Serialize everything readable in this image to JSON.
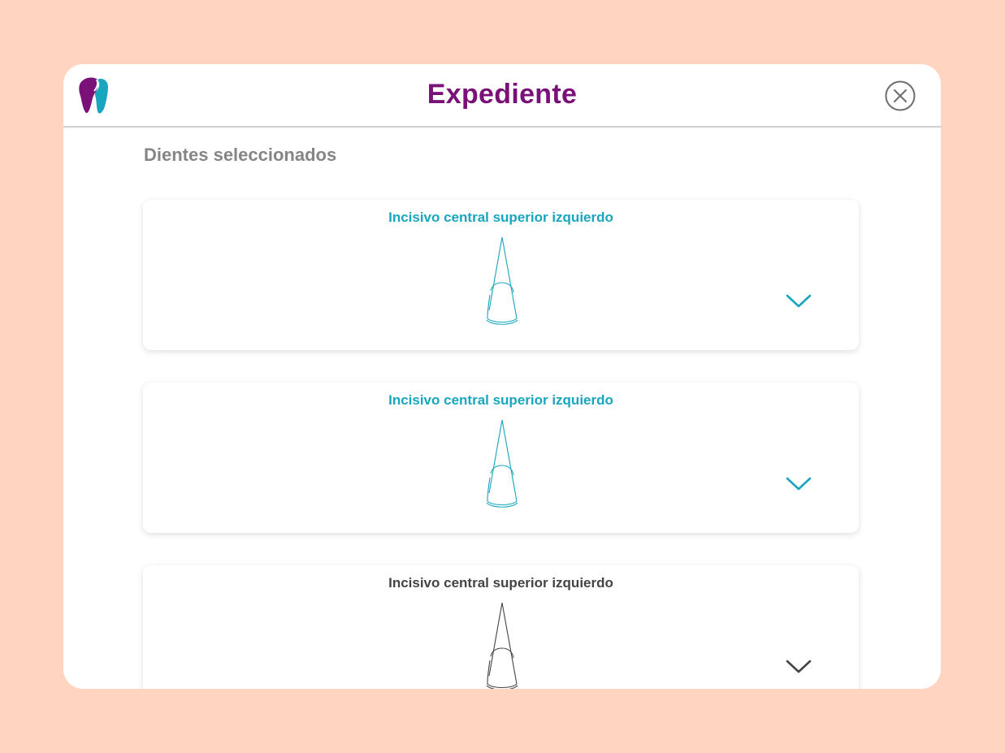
{
  "header": {
    "title": "Expediente",
    "logo_icon": "tooth-logo-icon",
    "close_icon": "close-circle-icon"
  },
  "section": {
    "title": "Dientes seleccionados"
  },
  "cards": [
    {
      "title": "Incisivo central superior izquierdo",
      "state": "selected",
      "color": "#18A6BE"
    },
    {
      "title": "Incisivo central superior izquierdo",
      "state": "selected",
      "color": "#18A6BE"
    },
    {
      "title": "Incisivo central superior izquierdo",
      "state": "default",
      "color": "#444444"
    }
  ],
  "colors": {
    "background": "#FFD4C0",
    "brand_purple": "#7A1178",
    "brand_teal": "#18A6BE",
    "section_gray": "#858585"
  }
}
